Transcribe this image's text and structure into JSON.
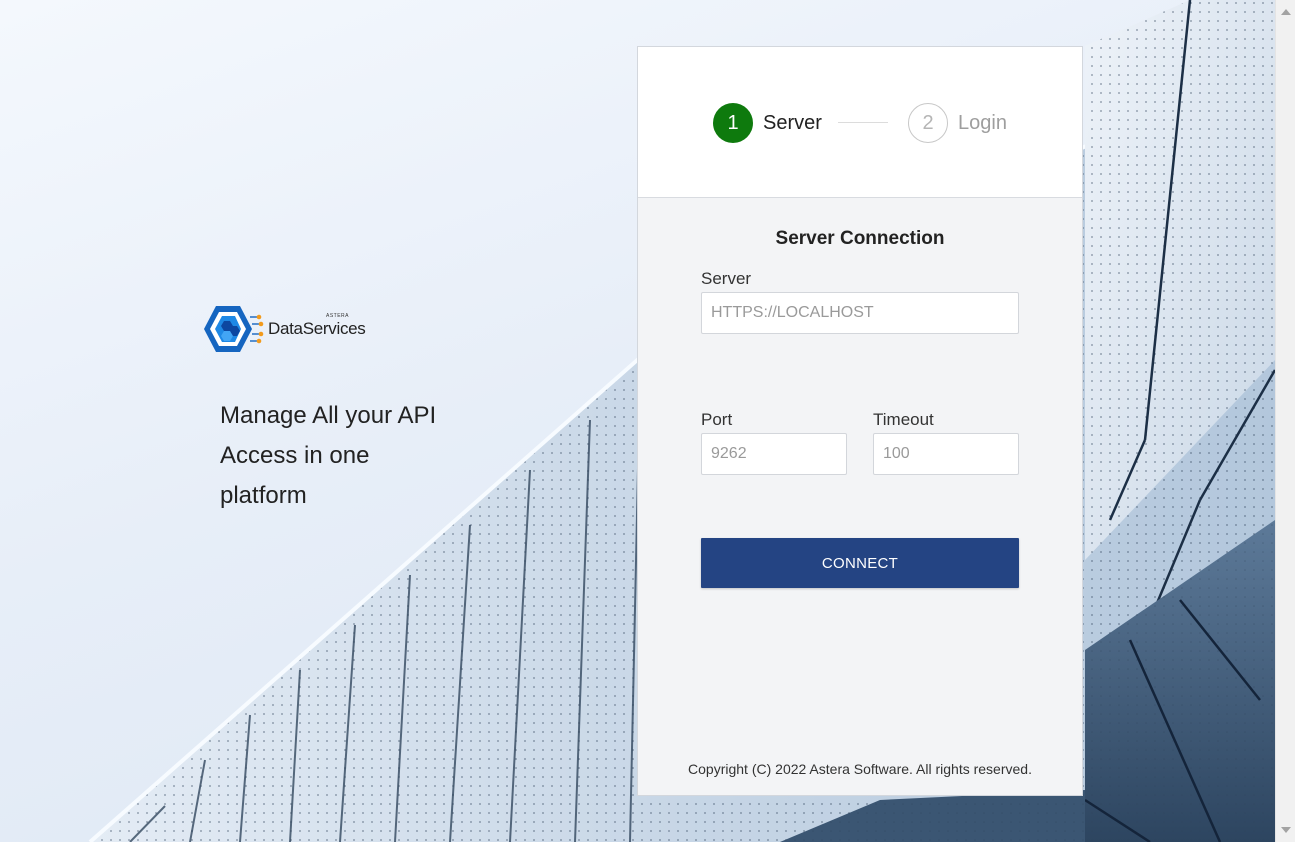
{
  "brand": {
    "small_text": "ASTERA",
    "name": "DataServices"
  },
  "tagline": "Manage All your API Access in one platform",
  "stepper": {
    "steps": [
      {
        "number": "1",
        "label": "Server",
        "state": "active"
      },
      {
        "number": "2",
        "label": "Login",
        "state": "inactive"
      }
    ]
  },
  "form": {
    "title": "Server Connection",
    "server": {
      "label": "Server",
      "placeholder": "HTTPS://LOCALHOST",
      "value": ""
    },
    "port": {
      "label": "Port",
      "placeholder": "9262",
      "value": ""
    },
    "timeout": {
      "label": "Timeout",
      "placeholder": "100",
      "value": ""
    },
    "connect_label": "CONNECT"
  },
  "footer": {
    "copyright": "Copyright (C) 2022 Astera Software. All rights reserved."
  },
  "colors": {
    "accent_green": "#0e7a0d",
    "button_blue": "#244483",
    "brand_blue": "#1565c0",
    "connector_orange": "#f29b1d"
  },
  "icons": {
    "logo": "hexagon-logo-icon",
    "scroll_up": "scroll-up-arrow-icon",
    "scroll_down": "scroll-down-arrow-icon"
  }
}
